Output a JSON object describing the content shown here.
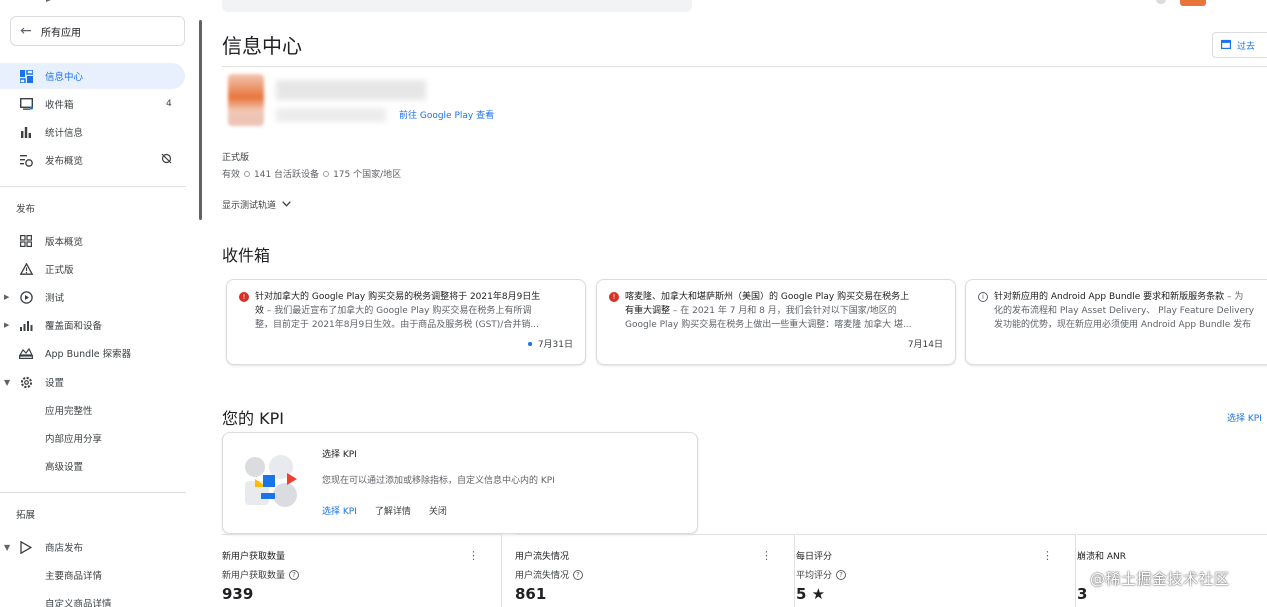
{
  "sidebar": {
    "all_apps_label": "所有应用",
    "items_top": [
      {
        "label": "信息中心",
        "icon": "dashboard-icon"
      },
      {
        "label": "收件箱",
        "icon": "inbox-icon",
        "badge": "4"
      },
      {
        "label": "统计信息",
        "icon": "bar-chart-icon"
      },
      {
        "label": "发布概览",
        "icon": "publishing-overview-icon"
      }
    ],
    "section_publish": "发布",
    "items_publish": [
      {
        "label": "版本概览",
        "icon": "grid-icon"
      },
      {
        "label": "正式版",
        "icon": "warning-icon"
      },
      {
        "label": "测试",
        "icon": "play-circle-icon"
      },
      {
        "label": "覆盖面和设备",
        "icon": "signal-icon"
      },
      {
        "label": "App Bundle 探索器",
        "icon": "bundle-icon"
      },
      {
        "label": "设置",
        "icon": "gear-icon"
      },
      {
        "label": "应用完整性",
        "icon": ""
      },
      {
        "label": "内部应用分享",
        "icon": ""
      },
      {
        "label": "高级设置",
        "icon": ""
      }
    ],
    "section_grow": "拓展",
    "items_grow": [
      {
        "label": "商店发布",
        "icon": "play-store-icon"
      },
      {
        "label": "主要商品详情",
        "icon": ""
      },
      {
        "label": "自定义商品详情",
        "icon": ""
      }
    ]
  },
  "header": {
    "title": "信息中心",
    "date_button": "过去"
  },
  "app": {
    "google_play_link": "前往 Google Play 查看",
    "release_label": "正式版",
    "status": "有效",
    "devices": "141 台活跃设备",
    "countries": "175 个国家/地区",
    "show_tracks": "显示测试轨道"
  },
  "inbox": {
    "title": "收件箱",
    "cards": [
      {
        "type": "error",
        "title": "针对加拿大的 Google Play 购买交易的税务调整将于 2021年8月9日生",
        "title2": "效",
        "body1": " – 我们最近宣布了加拿大的 Google Play 购买交易在税务上有所调",
        "body2": "整，目前定于 2021年8月9日生效。由于商品及服务税 (GST)/合并销...",
        "date": "7月31日",
        "unread": true
      },
      {
        "type": "error",
        "title": "喀麦隆、加拿大和堪萨斯州（美国）的 Google Play 购买交易在税务上",
        "title2": "有重大调整",
        "body1": " – 在 2021 年 7 月和 8 月，我们会针对以下国家/地区的",
        "body2": "Google Play 购买交易在税务上做出一些重大调整：喀麦隆 加拿大 堪...",
        "date": "7月14日",
        "unread": false
      },
      {
        "type": "info",
        "title": "针对新应用的 Android App Bundle 要求和新版服务条款",
        "title2": "",
        "body1": " – 为",
        "body2a": "化的发布流程和 Play Asset Delivery、 Play Feature Delivery",
        "body2": "发功能的优势，现在新应用必须使用 Android App Bundle 发布",
        "date": "",
        "unread": false
      }
    ]
  },
  "kpi": {
    "title": "您的 KPI",
    "choose_link": "选择 KPI",
    "card": {
      "title": "选择 KPI",
      "description": "您现在可以通过添加或移除指标，自定义信息中心内的 KPI",
      "action_choose": "选择 KPI",
      "action_learn": "了解详情",
      "action_close": "关闭"
    },
    "metrics": [
      {
        "header": "新用户获取数量",
        "sub": "新用户获取数量",
        "value": "939"
      },
      {
        "header": "用户流失情况",
        "sub": "用户流失情况",
        "value": "861"
      },
      {
        "header": "每日评分",
        "sub": "平均评分",
        "value": "5 ★"
      },
      {
        "header": "崩溃和 ANR",
        "sub": "",
        "value": "3"
      }
    ]
  },
  "watermark": "@稀土掘金技术社区",
  "colors": {
    "accent": "#1a73e8",
    "error": "#d93025",
    "active_bg": "#e8f0fe"
  }
}
